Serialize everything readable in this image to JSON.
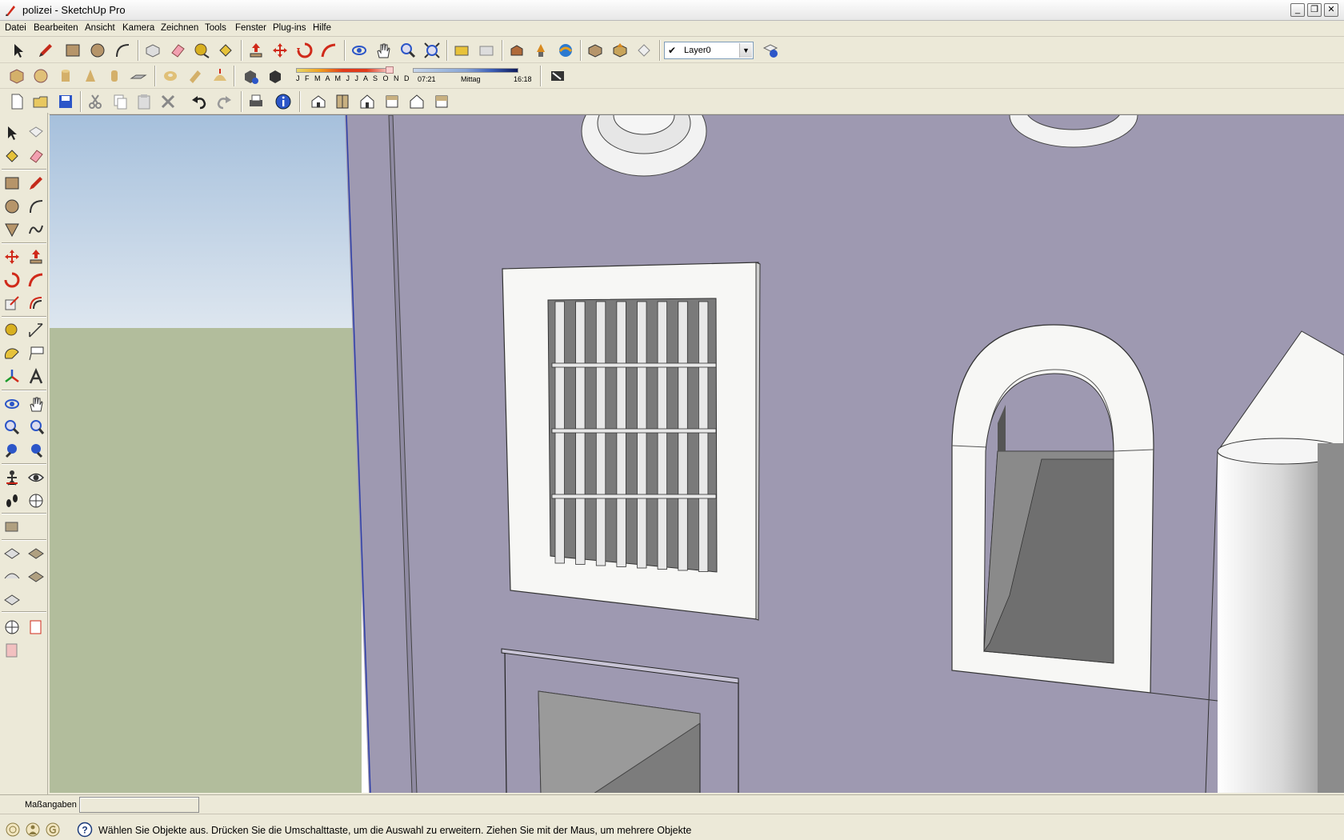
{
  "window": {
    "title": "polizei - SketchUp Pro",
    "minimize_glyph": "_",
    "maximize_glyph": "❐",
    "close_glyph": "✕"
  },
  "menu": {
    "items": [
      "Datei",
      "Bearbeiten",
      "Ansicht",
      "Kamera",
      "Zeichnen",
      "Tools",
      "Fenster",
      "Plug-ins",
      "Hilfe"
    ]
  },
  "layers": {
    "current": "Layer0",
    "check": "✔",
    "arrow": "▼"
  },
  "shadows": {
    "months": "J F M A M J J A S O N D",
    "sunrise": "07:21",
    "noon": "Mittag",
    "sunset": "16:18"
  },
  "measure": {
    "label": "Maßangaben",
    "value": ""
  },
  "status": {
    "message": "Wählen Sie Objekte aus. Drücken Sie die Umschalttaste, um die Auswahl zu erweitern. Ziehen Sie mit der Maus, um mehrere Objekte"
  },
  "colors": {
    "sky": "#a9c3de",
    "ground": "#b2bd9c",
    "wall": "#9e99b1",
    "frame": "#f7f7f5",
    "opening": "#6f6f6f",
    "accent_blue": "#3b5bd0",
    "accent_red": "#d82a1a"
  },
  "icons": {
    "toolbar1": [
      "select-icon",
      "pencil-icon",
      "rectangle-icon",
      "circle-icon",
      "arc-icon",
      "make-component-icon",
      "eraser-icon",
      "tape-measure-icon",
      "paint-bucket-icon",
      "push-pull-icon",
      "move-icon",
      "rotate-icon",
      "follow-me-icon",
      "orbit-icon",
      "pan-icon",
      "zoom-icon",
      "zoom-extents-icon",
      "previous-scene-icon",
      "next-scene-icon",
      "place-model-icon",
      "get-models-icon",
      "share-model-icon",
      "share-component-icon",
      "layer-manager-icon"
    ],
    "toolbar2": [
      "box-icon",
      "sphere-icon",
      "cylinder-icon",
      "cone-icon",
      "cylinder-2-icon",
      "plane-icon",
      "torus-icon",
      "tube-icon",
      "dome-icon",
      "shadow-settings-icon",
      "display-shadows-icon",
      "section-plane-icon"
    ],
    "toolbar3": [
      "new-icon",
      "open-icon",
      "save-icon",
      "cut-icon",
      "copy-icon",
      "paste-icon",
      "delete-icon",
      "undo-icon",
      "redo-icon",
      "print-icon",
      "model-info-icon",
      "iso-view-icon",
      "top-view-icon",
      "front-view-icon",
      "right-view-icon",
      "back-view-icon",
      "left-view-icon"
    ]
  }
}
